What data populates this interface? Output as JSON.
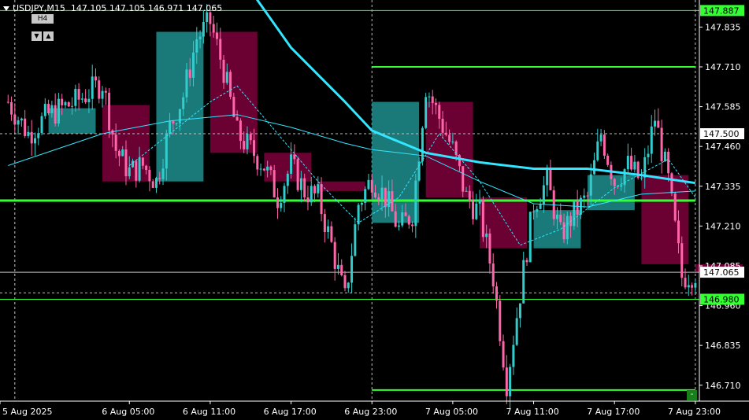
{
  "header": {
    "symbol": "USDJPY,M15",
    "ohlc": "147.105 147.105 146.971 147.065"
  },
  "controls": {
    "timeframe": "H4",
    "scroll_left": "▼",
    "scroll_right": "▲",
    "minus": "-"
  },
  "colors": {
    "bull": "#33cccc",
    "bear": "#ff66aa",
    "box_bull": "#1a7a7a",
    "box_bear": "#6b0033",
    "ma": "#33e6ff",
    "level": "#33ff33",
    "grid": "#c0c0c0"
  },
  "chart_data": {
    "type": "candlestick",
    "title": "USDJPY,M15",
    "y_range": [
      146.66,
      147.92
    ],
    "y_ticks": [
      "147.835",
      "147.710",
      "147.585",
      "147.460",
      "147.335",
      "147.210",
      "147.085",
      "146.960",
      "146.835",
      "146.710"
    ],
    "x_ticks": [
      "5 Aug 2025",
      "6 Aug 05:00",
      "6 Aug 11:00",
      "6 Aug 17:00",
      "6 Aug 23:00",
      "7 Aug 05:00",
      "7 Aug 11:00",
      "7 Aug 17:00",
      "7 Aug 23:00"
    ],
    "price_labels": [
      {
        "value": 147.887,
        "text": "147.887",
        "style": "green"
      },
      {
        "value": 147.5,
        "text": "147.500",
        "style": "white"
      },
      {
        "value": 147.065,
        "text": "147.065",
        "style": "white"
      },
      {
        "value": 146.98,
        "text": "146.980",
        "style": "green"
      }
    ],
    "horizontal_levels": [
      {
        "value": 147.887,
        "color": "#33ff33",
        "width": 1,
        "full": true
      },
      {
        "value": 147.065,
        "color": "#c0c0c0",
        "width": 1,
        "full": true
      },
      {
        "value": 146.98,
        "color": "#33ff33",
        "width": 1,
        "full": true
      },
      {
        "value": 147.71,
        "color": "#33ff33",
        "width": 2,
        "from": "6 Aug 23:00",
        "to": "7 Aug 23:00"
      },
      {
        "value": 147.29,
        "color": "#33ff33",
        "width": 3,
        "from": "5 Aug 2025",
        "to": "7 Aug 23:00"
      },
      {
        "value": 146.695,
        "color": "#33ff33",
        "width": 2,
        "from": "6 Aug 23:00",
        "to": "7 Aug 23:00"
      }
    ],
    "dotted_levels": [
      147.5,
      147.0
    ],
    "h4_boxes": [
      {
        "start": "5 Aug 23:00",
        "open": 147.58,
        "close": 147.5,
        "dir": "bull"
      },
      {
        "start": "6 Aug 03:00",
        "open": 147.59,
        "close": 147.35,
        "dir": "bear"
      },
      {
        "start": "6 Aug 07:00",
        "open": 147.35,
        "close": 147.82,
        "dir": "bull"
      },
      {
        "start": "6 Aug 11:00",
        "open": 147.82,
        "close": 147.44,
        "dir": "bear"
      },
      {
        "start": "6 Aug 15:00",
        "open": 147.44,
        "close": 147.35,
        "dir": "bear"
      },
      {
        "start": "6 Aug 19:00",
        "open": 147.35,
        "close": 147.32,
        "dir": "bear"
      },
      {
        "start": "6 Aug 23:00",
        "open": 147.22,
        "close": 147.6,
        "dir": "bull"
      },
      {
        "start": "7 Aug 03:00",
        "open": 147.6,
        "close": 147.3,
        "dir": "bear"
      },
      {
        "start": "7 Aug 07:00",
        "open": 147.3,
        "close": 147.14,
        "dir": "bear"
      },
      {
        "start": "7 Aug 11:00",
        "open": 147.14,
        "close": 147.26,
        "dir": "bull"
      },
      {
        "start": "7 Aug 15:00",
        "open": 147.26,
        "close": 147.37,
        "dir": "bull"
      },
      {
        "start": "7 Aug 19:00",
        "open": 147.37,
        "close": 147.09,
        "dir": "bear"
      },
      {
        "start": "7 Aug 23:00",
        "open": 147.09,
        "close": 147.065,
        "dir": "bear"
      }
    ],
    "close_path": [
      [
        "5 Aug 20:00",
        147.6
      ],
      [
        "5 Aug 21:30",
        147.5
      ],
      [
        "5 Aug 23:00",
        147.56
      ],
      [
        "6 Aug 01:00",
        147.6
      ],
      [
        "6 Aug 03:00",
        147.66
      ],
      [
        "6 Aug 04:00",
        147.45
      ],
      [
        "6 Aug 05:00",
        147.38
      ],
      [
        "6 Aug 06:00",
        147.4
      ],
      [
        "6 Aug 07:00",
        147.35
      ],
      [
        "6 Aug 08:00",
        147.52
      ],
      [
        "6 Aug 09:00",
        147.62
      ],
      [
        "6 Aug 10:00",
        147.8
      ],
      [
        "6 Aug 11:00",
        147.85
      ],
      [
        "6 Aug 12:00",
        147.7
      ],
      [
        "6 Aug 13:00",
        147.5
      ],
      [
        "6 Aug 14:00",
        147.45
      ],
      [
        "6 Aug 15:00",
        147.4
      ],
      [
        "6 Aug 16:00",
        147.3
      ],
      [
        "6 Aug 17:00",
        147.4
      ],
      [
        "6 Aug 18:00",
        147.32
      ],
      [
        "6 Aug 19:00",
        147.3
      ],
      [
        "6 Aug 20:00",
        147.15
      ],
      [
        "6 Aug 21:00",
        146.98
      ],
      [
        "6 Aug 22:00",
        147.28
      ],
      [
        "6 Aug 23:00",
        147.36
      ],
      [
        "7 Aug 00:00",
        147.3
      ],
      [
        "7 Aug 01:00",
        147.2
      ],
      [
        "7 Aug 02:00",
        147.25
      ],
      [
        "7 Aug 03:00",
        147.65
      ],
      [
        "7 Aug 04:00",
        147.55
      ],
      [
        "7 Aug 05:00",
        147.45
      ],
      [
        "7 Aug 06:00",
        147.3
      ],
      [
        "7 Aug 07:00",
        147.25
      ],
      [
        "7 Aug 08:00",
        147.05
      ],
      [
        "7 Aug 09:00",
        146.72
      ],
      [
        "7 Aug 10:00",
        147.0
      ],
      [
        "7 Aug 11:00",
        147.28
      ],
      [
        "7 Aug 12:00",
        147.35
      ],
      [
        "7 Aug 13:00",
        147.18
      ],
      [
        "7 Aug 14:00",
        147.25
      ],
      [
        "7 Aug 15:00",
        147.3
      ],
      [
        "7 Aug 16:00",
        147.5
      ],
      [
        "7 Aug 17:00",
        147.35
      ],
      [
        "7 Aug 18:00",
        147.4
      ],
      [
        "7 Aug 19:00",
        147.35
      ],
      [
        "7 Aug 20:00",
        147.55
      ],
      [
        "7 Aug 21:00",
        147.35
      ],
      [
        "7 Aug 22:00",
        147.05
      ],
      [
        "7 Aug 23:00",
        147.065
      ]
    ],
    "ma_slow": [
      [
        "6 Aug 14:00",
        147.95
      ],
      [
        "6 Aug 17:00",
        147.77
      ],
      [
        "6 Aug 21:00",
        147.6
      ],
      [
        "6 Aug 23:00",
        147.51
      ],
      [
        "7 Aug 03:00",
        147.44
      ],
      [
        "7 Aug 07:00",
        147.41
      ],
      [
        "7 Aug 11:00",
        147.39
      ],
      [
        "7 Aug 15:00",
        147.39
      ],
      [
        "7 Aug 19:00",
        147.37
      ],
      [
        "7 Aug 23:00",
        147.345
      ]
    ],
    "ma_mid": [
      [
        "5 Aug 20:00",
        147.4
      ],
      [
        "6 Aug 03:00",
        147.5
      ],
      [
        "6 Aug 08:00",
        147.54
      ],
      [
        "6 Aug 13:00",
        147.56
      ],
      [
        "6 Aug 17:00",
        147.52
      ],
      [
        "6 Aug 21:00",
        147.47
      ],
      [
        "6 Aug 23:00",
        147.45
      ],
      [
        "7 Aug 03:00",
        147.43
      ],
      [
        "7 Aug 07:00",
        147.35
      ],
      [
        "7 Aug 11:00",
        147.28
      ],
      [
        "7 Aug 15:00",
        147.27
      ],
      [
        "7 Aug 19:00",
        147.31
      ],
      [
        "7 Aug 23:00",
        147.32
      ]
    ],
    "ma_fast_dashed": [
      [
        "6 Aug 05:00",
        147.4
      ],
      [
        "6 Aug 08:00",
        147.5
      ],
      [
        "6 Aug 11:00",
        147.6
      ],
      [
        "6 Aug 13:00",
        147.65
      ],
      [
        "6 Aug 16:00",
        147.5
      ],
      [
        "6 Aug 19:00",
        147.35
      ],
      [
        "6 Aug 22:00",
        147.22
      ],
      [
        "7 Aug 01:00",
        147.3
      ],
      [
        "7 Aug 04:00",
        147.5
      ],
      [
        "7 Aug 07:00",
        147.35
      ],
      [
        "7 Aug 10:00",
        147.15
      ],
      [
        "7 Aug 13:00",
        147.2
      ],
      [
        "7 Aug 17:00",
        147.33
      ],
      [
        "7 Aug 21:00",
        147.42
      ],
      [
        "7 Aug 23:00",
        147.3
      ]
    ]
  }
}
